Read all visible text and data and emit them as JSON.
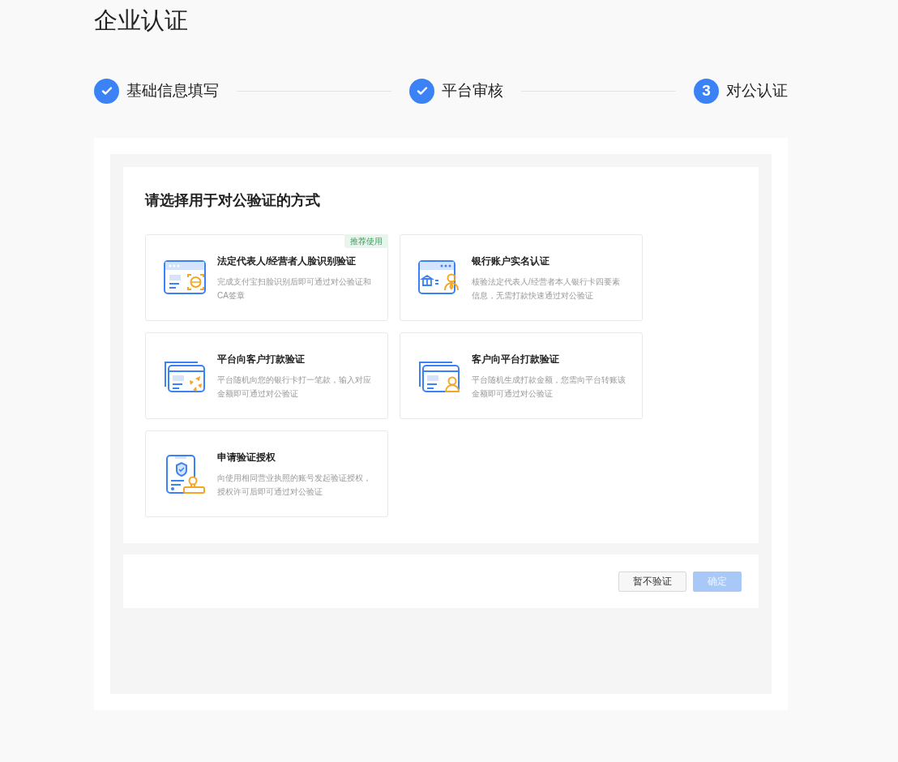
{
  "page_title": "企业认证",
  "steps": [
    {
      "label": "基础信息填写",
      "done": true
    },
    {
      "label": "平台审核",
      "done": true
    },
    {
      "label": "对公认证",
      "done": false,
      "number": "3"
    }
  ],
  "methods_title": "请选择用于对公验证的方式",
  "methods": [
    {
      "kind": "face",
      "title": "法定代表人/经营者人脸识别验证",
      "description": "完成支付宝扫脸识别后即可通过对公验证和CA签章",
      "tag": "推荐使用"
    },
    {
      "kind": "bank",
      "title": "银行账户实名认证",
      "description": "核验法定代表人/经营者本人银行卡四要素信息，无需打款快速通过对公验证"
    },
    {
      "kind": "pay_out",
      "title": "平台向客户打款验证",
      "description": "平台随机向您的银行卡打一笔款，输入对应金额即可通过对公验证"
    },
    {
      "kind": "pay_in",
      "title": "客户向平台打款验证",
      "description": "平台随机生成打款金额，您需向平台转账该金额即可通过对公验证"
    },
    {
      "kind": "authorize",
      "title": "申请验证授权",
      "description": "向使用相同营业执照的账号发起验证授权，授权许可后即可通过对公验证"
    }
  ],
  "buttons": [
    {
      "label": "暂不验证",
      "kind": "secondary",
      "disabled": false
    },
    {
      "label": "确定",
      "kind": "primary",
      "disabled": true
    }
  ]
}
